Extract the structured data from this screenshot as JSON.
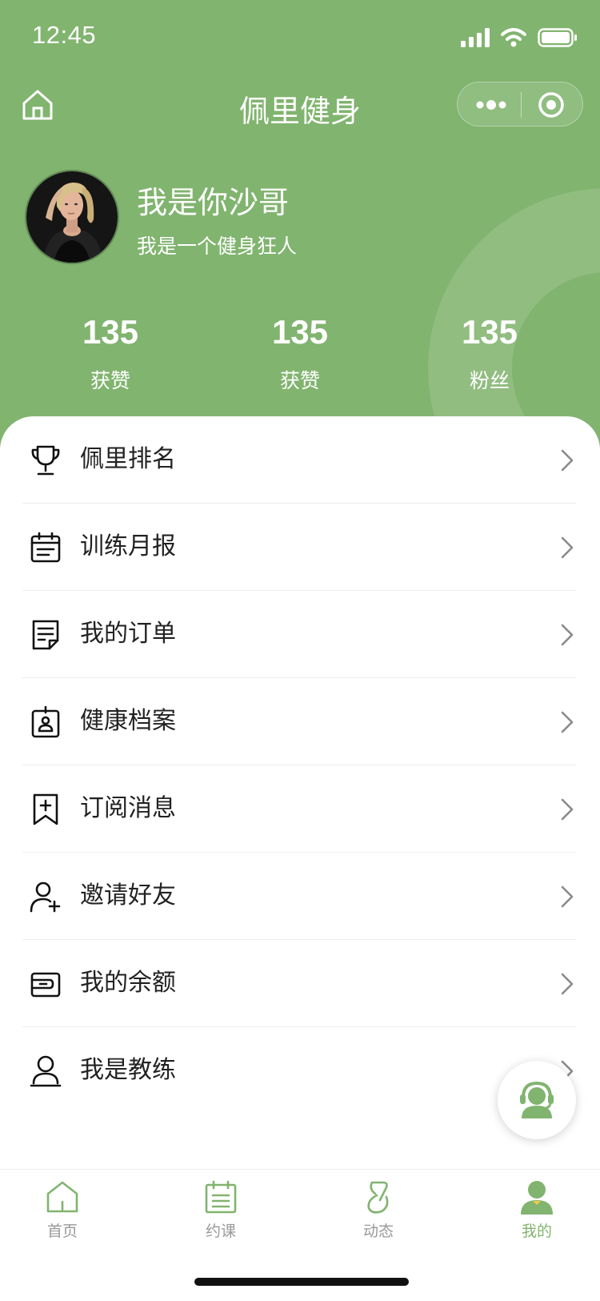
{
  "colors": {
    "brand_green": "#81b46f",
    "text": "#222222",
    "muted": "#999999"
  },
  "status_bar": {
    "time": "12:45",
    "icons": [
      "signal-icon",
      "wifi-icon",
      "battery-icon"
    ]
  },
  "nav": {
    "title": "佩里健身",
    "home_icon": "home-icon",
    "capsule": [
      "more-icon",
      "target-icon"
    ]
  },
  "profile": {
    "name": "我是你沙哥",
    "bio": "我是一个健身狂人",
    "avatar": "avatar-photo"
  },
  "stats": [
    {
      "value": "135",
      "label": "获赞"
    },
    {
      "value": "135",
      "label": "获赞"
    },
    {
      "value": "135",
      "label": "粉丝"
    }
  ],
  "menu": [
    {
      "label": "佩里排名",
      "icon": "trophy-icon"
    },
    {
      "label": "训练月报",
      "icon": "calendar-icon"
    },
    {
      "label": "我的订单",
      "icon": "order-doc-icon"
    },
    {
      "label": "健康档案",
      "icon": "health-file-icon"
    },
    {
      "label": "订阅消息",
      "icon": "bookmark-plus-icon"
    },
    {
      "label": "邀请好友",
      "icon": "add-user-icon"
    },
    {
      "label": "我的余额",
      "icon": "wallet-icon"
    },
    {
      "label": "我是教练",
      "icon": "coach-icon"
    }
  ],
  "support_button": {
    "icon": "customer-service-icon"
  },
  "tabbar": [
    {
      "label": "首页",
      "icon": "home-icon"
    },
    {
      "label": "约课",
      "icon": "schedule-icon"
    },
    {
      "label": "动态",
      "icon": "moments-icon"
    },
    {
      "label": "我的",
      "icon": "profile-icon",
      "active": true
    }
  ]
}
